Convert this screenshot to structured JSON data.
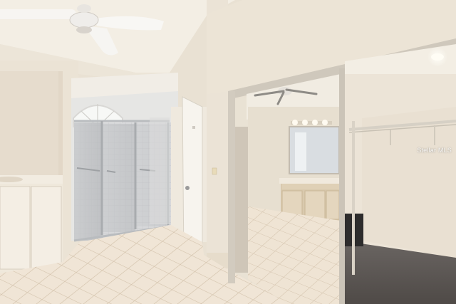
{
  "photo": {
    "watermark": "Stellar MLS"
  },
  "colors": {
    "wall": "#ece4d6",
    "ceiling": "#f3ede2",
    "tile": "#efe3d3",
    "grout": "#d6c6b1",
    "cabinet": "#efe8da",
    "mirror_frame": "#c9c2b6",
    "carpet": "#5f5a57"
  },
  "icons": [
    "ceiling-fan",
    "shower-enclosure",
    "arched-window",
    "vanity-light",
    "wire-shelf"
  ]
}
